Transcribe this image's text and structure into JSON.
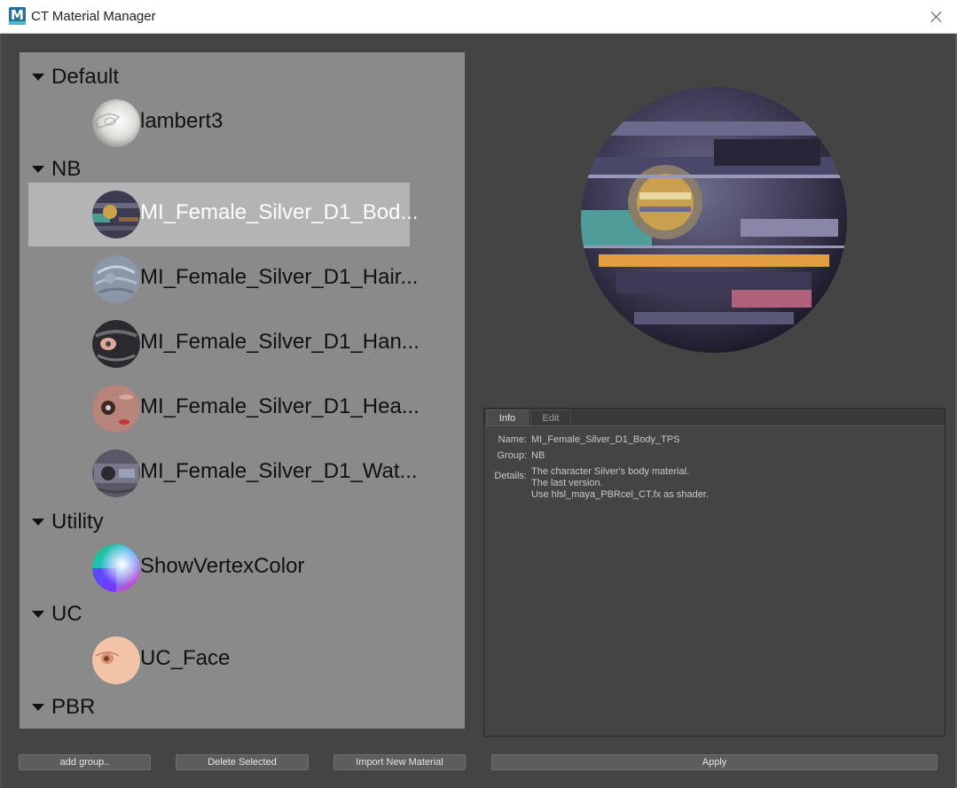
{
  "window": {
    "title": "CT Material Manager",
    "logo_letter": "M",
    "close_label": ""
  },
  "groups": [
    {
      "name": "Default",
      "materials": [
        {
          "name": "lambert3"
        }
      ]
    },
    {
      "name": "NB",
      "materials": [
        {
          "name": "MI_Female_Silver_D1_Bod...",
          "selected": true
        },
        {
          "name": "MI_Female_Silver_D1_Hair..."
        },
        {
          "name": "MI_Female_Silver_D1_Han..."
        },
        {
          "name": "MI_Female_Silver_D1_Hea..."
        },
        {
          "name": "MI_Female_Silver_D1_Wat..."
        }
      ]
    },
    {
      "name": "Utility",
      "materials": [
        {
          "name": "ShowVertexColor"
        }
      ]
    },
    {
      "name": "UC",
      "materials": [
        {
          "name": "UC_Face"
        }
      ]
    },
    {
      "name": "PBR",
      "materials": []
    }
  ],
  "info": {
    "tabs": [
      "Info",
      "Edit"
    ],
    "active_tab": "Info",
    "name_label": "Name:",
    "name_value": "MI_Female_Silver_D1_Body_TPS",
    "group_label": "Group:",
    "group_value": "NB",
    "details_label": "Details:",
    "details_lines": [
      "The character Silver's body material.",
      "The last version.",
      "Use hlsl_maya_PBRcel_CT.fx as shader."
    ]
  },
  "buttons": {
    "add_group": "add group..",
    "delete_selected": "Delete Selected",
    "import_new": "Import New Material",
    "apply": "Apply"
  },
  "colors": {
    "background": "#444444",
    "list_background": "#8a8a8a",
    "selected_row": "#b4b4b4",
    "button": "#5d5d5d"
  }
}
